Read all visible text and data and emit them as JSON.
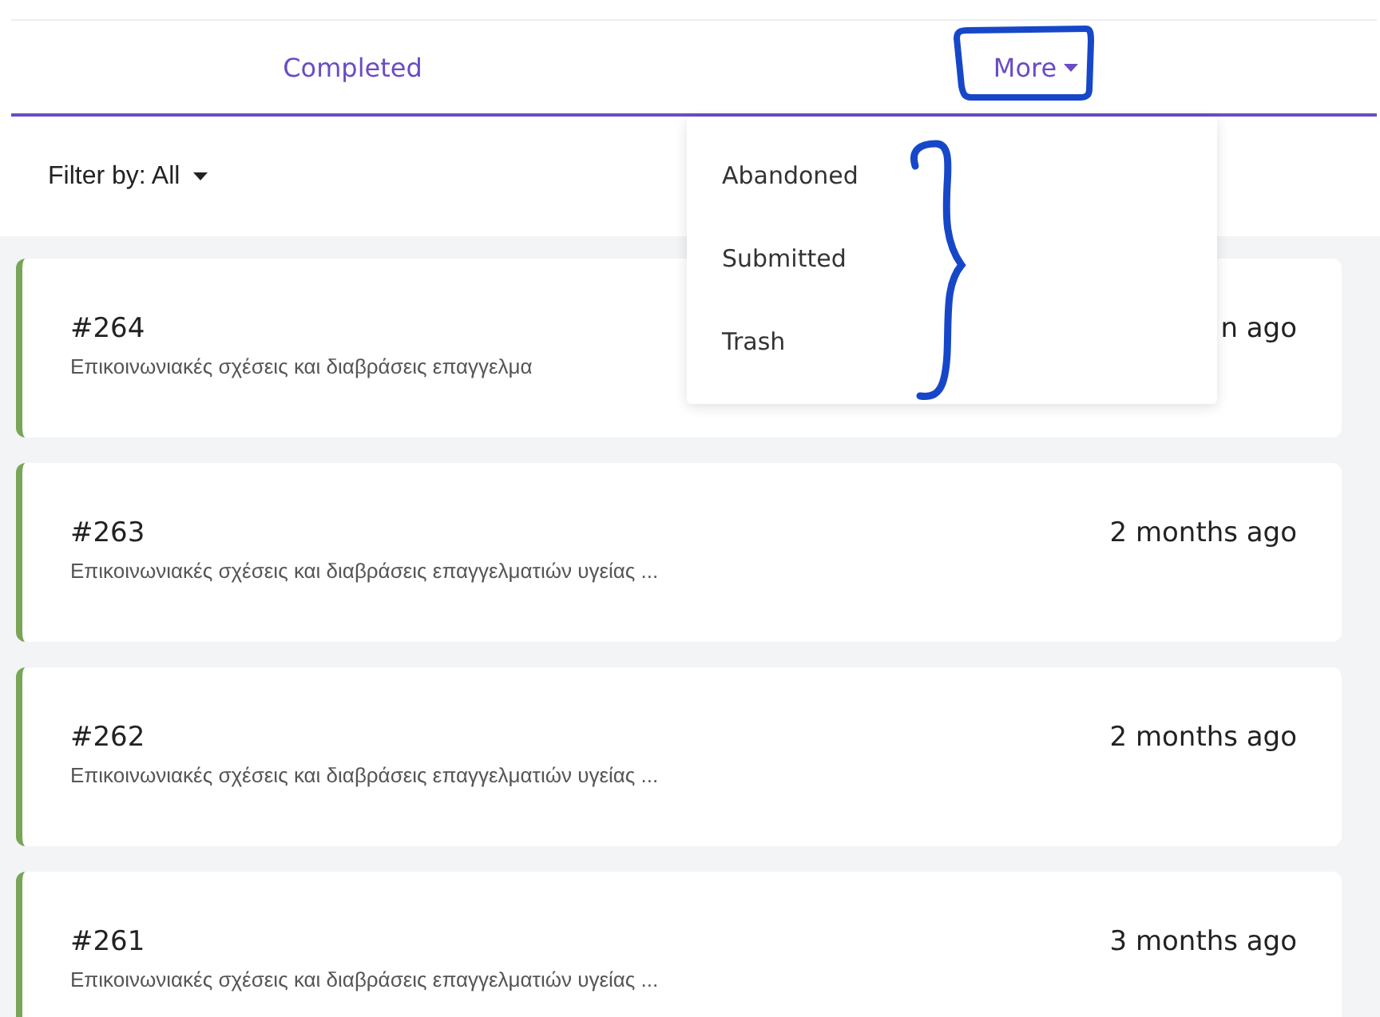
{
  "tabs": [
    {
      "label": "Completed",
      "selected": false,
      "kind": "plain"
    },
    {
      "label": "More",
      "selected": false,
      "kind": "dropdown",
      "expanded": true
    }
  ],
  "more_menu": {
    "items": [
      "Abandoned",
      "Submitted",
      "Trash"
    ]
  },
  "filter": {
    "label": "Filter by: All"
  },
  "cards": [
    {
      "number": "#264",
      "description": "Επικοινωνιακές σχέσεις και διαβράσεις επαγγελμα",
      "time": "n ago"
    },
    {
      "number": "#263",
      "description": "Επικοινωνιακές σχέσεις και διαβράσεις επαγγελματιών υγείας ...",
      "time": "2 months ago"
    },
    {
      "number": "#262",
      "description": "Επικοινωνιακές σχέσεις και διαβράσεις επαγγελματιών υγείας ...",
      "time": "2 months ago"
    },
    {
      "number": "#261",
      "description": "Επικοινωνιακές σχέσεις και διαβράσεις επαγγελματιών υγείας ...",
      "time": "3 months ago"
    }
  ]
}
